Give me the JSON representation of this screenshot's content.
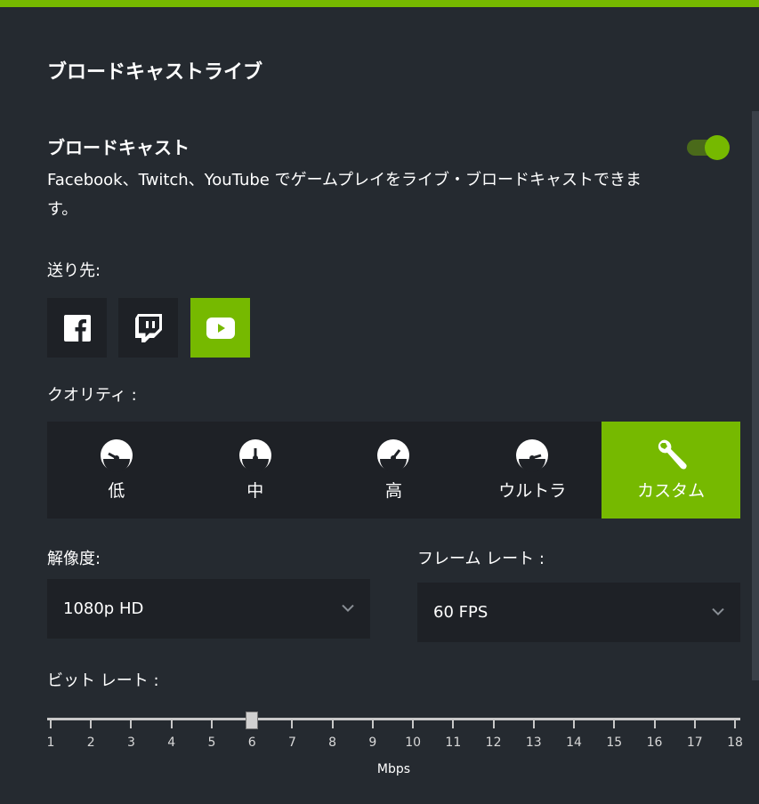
{
  "colors": {
    "accent": "#76b900",
    "background": "#252a30",
    "panel": "#1e2126"
  },
  "page_title": "ブロードキャストライブ",
  "broadcast": {
    "title": "ブロードキャスト",
    "description": "Facebook、Twitch、YouTube でゲームプレイをライブ・ブロードキャストできます。",
    "toggle_on": true
  },
  "destination": {
    "label": "送り先:",
    "options": [
      {
        "icon": "facebook-icon",
        "active": false
      },
      {
        "icon": "twitch-icon",
        "active": false
      },
      {
        "icon": "youtube-icon",
        "active": true
      }
    ]
  },
  "quality": {
    "label": "クオリティ :",
    "options": [
      {
        "label": "低",
        "icon": "gauge-low-icon",
        "active": false
      },
      {
        "label": "中",
        "icon": "gauge-medium-icon",
        "active": false
      },
      {
        "label": "高",
        "icon": "gauge-high-icon",
        "active": false
      },
      {
        "label": "ウルトラ",
        "icon": "gauge-ultra-icon",
        "active": false
      },
      {
        "label": "カスタム",
        "icon": "wrench-icon",
        "active": true
      }
    ]
  },
  "resolution": {
    "label": "解像度:",
    "value": "1080p HD"
  },
  "framerate": {
    "label": "フレーム レート :",
    "value": "60 FPS"
  },
  "bitrate": {
    "label": "ビット レート :",
    "min": 1,
    "max": 18,
    "value": 6,
    "ticks": [
      "1",
      "2",
      "3",
      "4",
      "5",
      "6",
      "7",
      "8",
      "9",
      "10",
      "11",
      "12",
      "13",
      "14",
      "15",
      "16",
      "17",
      "18"
    ],
    "unit": "Mbps"
  }
}
